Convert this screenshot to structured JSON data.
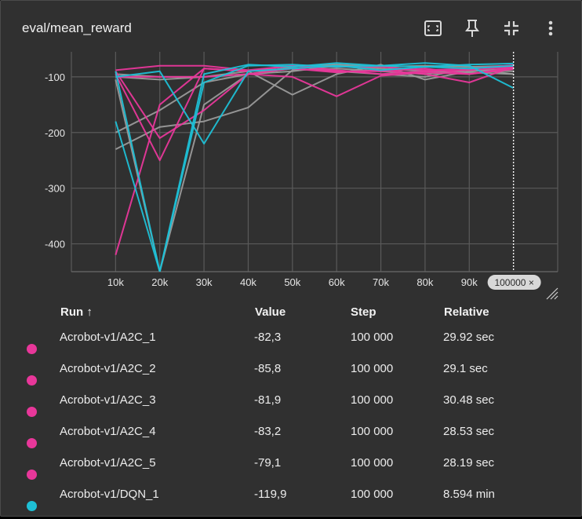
{
  "card": {
    "title": "eval/mean_reward",
    "tools": [
      "fit-to-data-icon",
      "pin-icon",
      "collapse-icon",
      "more-vert-icon"
    ]
  },
  "table": {
    "headers": {
      "run": "Run ↑",
      "value": "Value",
      "step": "Step",
      "relative": "Relative"
    },
    "rows": [
      {
        "color": "#e8379a",
        "run": "Acrobot-v1/A2C_1",
        "value": "-82,3",
        "step": "100 000",
        "relative": "29.92 sec"
      },
      {
        "color": "#e8379a",
        "run": "Acrobot-v1/A2C_2",
        "value": "-85,8",
        "step": "100 000",
        "relative": "29.1 sec"
      },
      {
        "color": "#e8379a",
        "run": "Acrobot-v1/A2C_3",
        "value": "-81,9",
        "step": "100 000",
        "relative": "30.48 sec"
      },
      {
        "color": "#e8379a",
        "run": "Acrobot-v1/A2C_4",
        "value": "-83,2",
        "step": "100 000",
        "relative": "28.53 sec"
      },
      {
        "color": "#e8379a",
        "run": "Acrobot-v1/A2C_5",
        "value": "-79,1",
        "step": "100 000",
        "relative": "28.19 sec"
      },
      {
        "color": "#1ec0d6",
        "run": "Acrobot-v1/DQN_1",
        "value": "-119,9",
        "step": "100 000",
        "relative": "8.594 min"
      }
    ]
  },
  "chart_data": {
    "type": "line",
    "title": "eval/mean_reward",
    "xlim": [
      0,
      110000
    ],
    "ylim": [
      -450,
      -55
    ],
    "x_ticks": [
      {
        "v": 10000,
        "label": "10k"
      },
      {
        "v": 20000,
        "label": "20k"
      },
      {
        "v": 30000,
        "label": "30k"
      },
      {
        "v": 40000,
        "label": "40k"
      },
      {
        "v": 50000,
        "label": "50k"
      },
      {
        "v": 60000,
        "label": "60k"
      },
      {
        "v": 70000,
        "label": "70k"
      },
      {
        "v": 80000,
        "label": "80k"
      },
      {
        "v": 90000,
        "label": "90k"
      }
    ],
    "y_ticks": [
      {
        "v": -100,
        "label": "-100"
      },
      {
        "v": -200,
        "label": "-200"
      },
      {
        "v": -300,
        "label": "-300"
      },
      {
        "v": -400,
        "label": "-400"
      }
    ],
    "cursor": {
      "x": 100000,
      "label": "100000 ×"
    },
    "grid": true,
    "series": [
      {
        "color": "#9a9a9a",
        "x": [
          10000,
          20000,
          30000,
          40000,
          50000,
          60000,
          70000,
          80000,
          90000,
          100000
        ],
        "values": [
          -230,
          -190,
          -180,
          -155,
          -88,
          -85,
          -90,
          -95,
          -88,
          -90
        ]
      },
      {
        "color": "#9a9a9a",
        "x": [
          10000,
          20000,
          30000,
          40000,
          50000,
          60000,
          70000,
          80000,
          90000,
          100000
        ],
        "values": [
          -200,
          -160,
          -110,
          -95,
          -90,
          -80,
          -85,
          -90,
          -92,
          -95
        ]
      },
      {
        "color": "#9a9a9a",
        "x": [
          10000,
          20000,
          30000,
          40000,
          50000,
          60000,
          70000,
          80000,
          90000,
          100000
        ],
        "values": [
          -100,
          -105,
          -100,
          -90,
          -132,
          -95,
          -78,
          -105,
          -90,
          -85
        ]
      },
      {
        "color": "#9a9a9a",
        "x": [
          10000,
          20000,
          30000,
          40000,
          50000,
          60000,
          70000,
          80000,
          90000,
          100000
        ],
        "values": [
          -95,
          -100,
          -100,
          -95,
          -85,
          -90,
          -95,
          -100,
          -85,
          -95
        ]
      },
      {
        "color": "#9a9a9a",
        "x": [
          10000,
          20000,
          30000,
          40000,
          50000,
          60000,
          70000,
          80000,
          90000,
          100000
        ],
        "values": [
          -105,
          -450,
          -150,
          -95,
          -82,
          -78,
          -82,
          -80,
          -82,
          -80
        ]
      },
      {
        "color": "#e8379a",
        "x": [
          10000,
          20000,
          30000,
          40000,
          50000,
          60000,
          70000,
          80000,
          90000,
          100000
        ],
        "values": [
          -420,
          -150,
          -85,
          -90,
          -80,
          -88,
          -95,
          -90,
          -88,
          -82
        ]
      },
      {
        "color": "#e8379a",
        "x": [
          10000,
          20000,
          30000,
          40000,
          50000,
          60000,
          70000,
          80000,
          90000,
          100000
        ],
        "values": [
          -95,
          -250,
          -85,
          -90,
          -85,
          -90,
          -90,
          -85,
          -95,
          -86
        ]
      },
      {
        "color": "#e8379a",
        "x": [
          10000,
          20000,
          30000,
          40000,
          50000,
          60000,
          70000,
          80000,
          90000,
          100000
        ],
        "values": [
          -90,
          -210,
          -160,
          -95,
          -85,
          -92,
          -88,
          -95,
          -110,
          -82
        ]
      },
      {
        "color": "#e8379a",
        "x": [
          10000,
          20000,
          30000,
          40000,
          50000,
          60000,
          70000,
          80000,
          90000,
          100000
        ],
        "values": [
          -100,
          -100,
          -100,
          -95,
          -100,
          -135,
          -98,
          -92,
          -95,
          -83
        ]
      },
      {
        "color": "#e8379a",
        "x": [
          10000,
          20000,
          30000,
          40000,
          50000,
          60000,
          70000,
          80000,
          90000,
          100000
        ],
        "values": [
          -88,
          -80,
          -80,
          -88,
          -80,
          -82,
          -82,
          -88,
          -85,
          -79
        ]
      },
      {
        "color": "#1ec0d6",
        "x": [
          10000,
          20000,
          30000,
          40000,
          50000,
          60000,
          70000,
          80000,
          90000,
          100000
        ],
        "values": [
          -90,
          -450,
          -110,
          -80,
          -78,
          -82,
          -80,
          -75,
          -80,
          -120
        ]
      },
      {
        "color": "#1ec0d6",
        "x": [
          10000,
          20000,
          30000,
          40000,
          50000,
          60000,
          70000,
          80000,
          90000,
          100000
        ],
        "values": [
          -180,
          -450,
          -95,
          -78,
          -82,
          -75,
          -80,
          -82,
          -78,
          -76
        ]
      },
      {
        "color": "#1ec0d6",
        "x": [
          10000,
          20000,
          30000,
          40000,
          50000,
          60000,
          70000,
          80000,
          90000,
          100000
        ],
        "values": [
          -100,
          -90,
          -220,
          -90,
          -85,
          -80,
          -88,
          -82,
          -85,
          -80
        ]
      }
    ]
  }
}
